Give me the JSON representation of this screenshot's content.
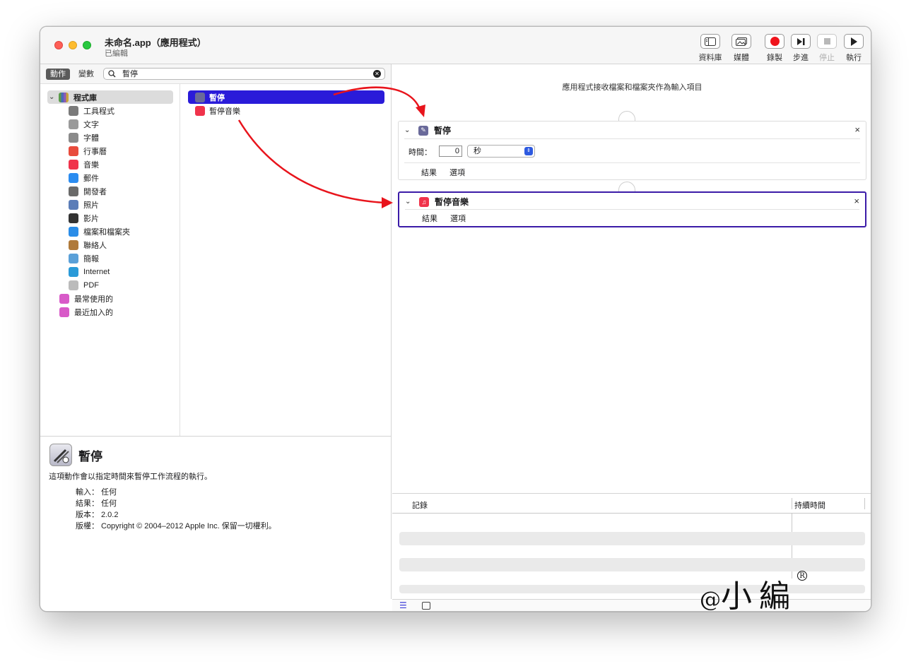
{
  "window": {
    "title": "未命名.app（應用程式）",
    "subtitle": "已編輯"
  },
  "toolbar": {
    "library": "資料庫",
    "media": "媒體",
    "record": "錄製",
    "step": "步進",
    "stop": "停止",
    "run": "執行"
  },
  "left": {
    "tab_actions": "動作",
    "tab_variables": "變數",
    "search_value": "暫停",
    "library_root": "程式庫",
    "library_items": [
      {
        "label": "工具程式",
        "icon": "tools-icon",
        "color": "#7a7a7a"
      },
      {
        "label": "文字",
        "icon": "text-icon",
        "color": "#9a9a9a"
      },
      {
        "label": "字體",
        "icon": "font-icon",
        "color": "#8a8a8a"
      },
      {
        "label": "行事曆",
        "icon": "calendar-icon",
        "color": "#e84b3c"
      },
      {
        "label": "音樂",
        "icon": "music-icon",
        "color": "#f0334b"
      },
      {
        "label": "郵件",
        "icon": "mail-icon",
        "color": "#2b8cf0"
      },
      {
        "label": "開發者",
        "icon": "developer-icon",
        "color": "#6a6a6a"
      },
      {
        "label": "照片",
        "icon": "photos-icon",
        "color": "#5b7db8"
      },
      {
        "label": "影片",
        "icon": "movies-icon",
        "color": "#333333"
      },
      {
        "label": "檔案和檔案夾",
        "icon": "finder-icon",
        "color": "#2a8de8"
      },
      {
        "label": "聯絡人",
        "icon": "contacts-icon",
        "color": "#b07a3a"
      },
      {
        "label": "簡報",
        "icon": "presentation-icon",
        "color": "#5aa0d8"
      },
      {
        "label": "Internet",
        "icon": "globe-icon",
        "color": "#2a9ad8"
      },
      {
        "label": "PDF",
        "icon": "pdf-icon",
        "color": "#bbbbbb"
      }
    ],
    "smart_folders": [
      {
        "label": "最常使用的",
        "icon": "smart-folder-icon",
        "color": "#d85ac8"
      },
      {
        "label": "最近加入的",
        "icon": "smart-folder-icon",
        "color": "#d85ac8"
      }
    ],
    "actions": [
      {
        "label": "暫停",
        "icon": "pause-action-icon",
        "color": "#6a6a9a",
        "selected": true
      },
      {
        "label": "暫停音樂",
        "icon": "music-icon",
        "color": "#f0334b",
        "selected": false
      }
    ],
    "description": {
      "title": "暫停",
      "text": "這項動作會以指定時間來暫停工作流程的執行。",
      "input_label": "輸入：",
      "input_value": "任何",
      "result_label": "結果：",
      "result_value": "任何",
      "version_label": "版本：",
      "version_value": "2.0.2",
      "copyright_label": "版權：",
      "copyright_value": "Copyright © 2004–2012 Apple Inc. 保留一切權利。"
    }
  },
  "workflow": {
    "hint": "應用程式接收檔案和檔案夾作為輸入項目",
    "card1": {
      "title": "暫停",
      "time_label": "時間：",
      "time_value": "0",
      "unit": "秒",
      "tab_results": "結果",
      "tab_options": "選項"
    },
    "card2": {
      "title": "暫停音樂",
      "tab_results": "結果",
      "tab_options": "選項"
    }
  },
  "log": {
    "col_log": "記錄",
    "col_duration": "持續時間"
  },
  "watermark": {
    "text": "小編",
    "reg": "R"
  },
  "colors": {
    "selection": "#2a1bd9",
    "selected_card_border": "#3b1ba8",
    "arrow": "#e8141c"
  }
}
